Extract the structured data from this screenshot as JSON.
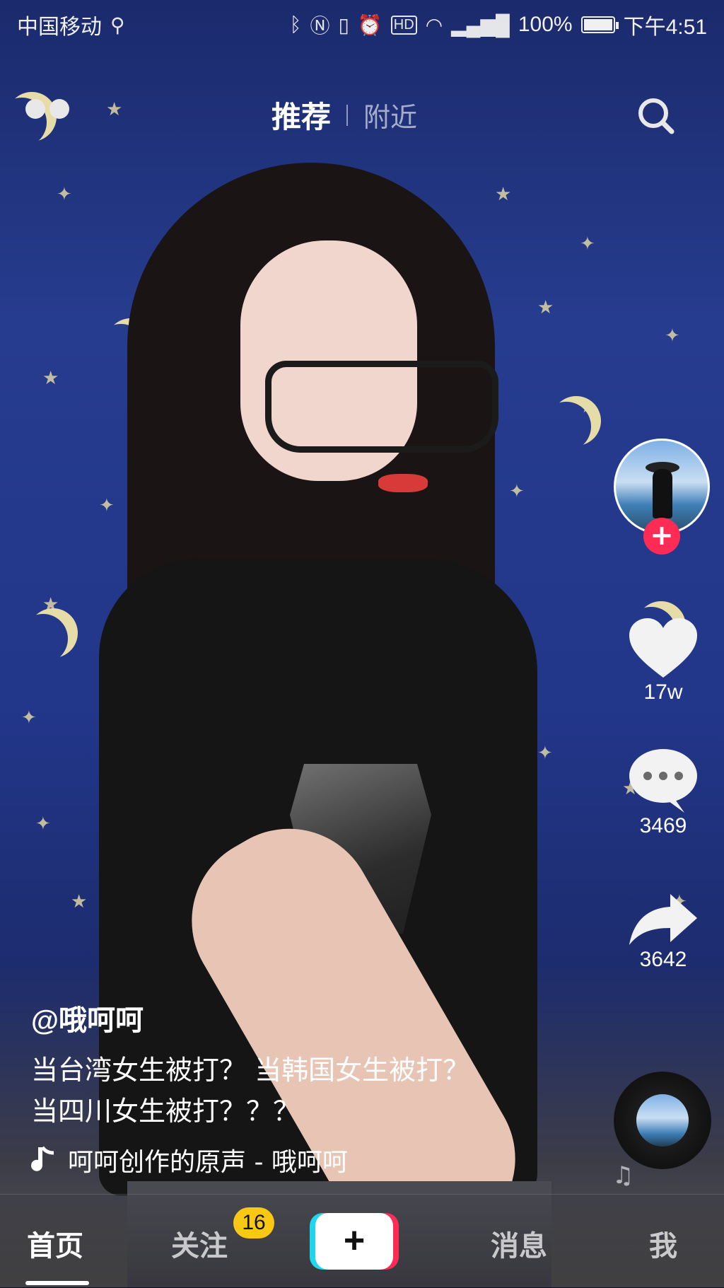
{
  "status_bar": {
    "carrier": "中国移动",
    "battery": "100%",
    "battery_level": 1.0,
    "time": "下午4:51",
    "icons": [
      "usb-icon",
      "bluetooth-icon",
      "nfc-icon",
      "vibrate-icon",
      "alarm-icon",
      "hd-icon",
      "wifi-icon",
      "signal-4g-icon",
      "battery-icon"
    ]
  },
  "top_bar": {
    "tab_active": "推荐",
    "tab_inactive": "附近"
  },
  "side_rail": {
    "likes": "17w",
    "comments": "3469",
    "shares": "3642",
    "follow_symbol": "+"
  },
  "video": {
    "username": "@哦呵呵",
    "description_line1": "当台湾女生被打？ 当韩国女生被打？",
    "description_line2": "当四川女生被打？？？",
    "music": "呵呵创作的原声 - 哦呵呵"
  },
  "bottom_nav": {
    "home": "首页",
    "follow": "关注",
    "follow_badge": "16",
    "create": "+",
    "messages": "消息",
    "me": "我"
  },
  "colors": {
    "accent_red": "#fe2c55",
    "accent_cyan": "#20d5ec",
    "badge_yellow": "#f8c815"
  }
}
